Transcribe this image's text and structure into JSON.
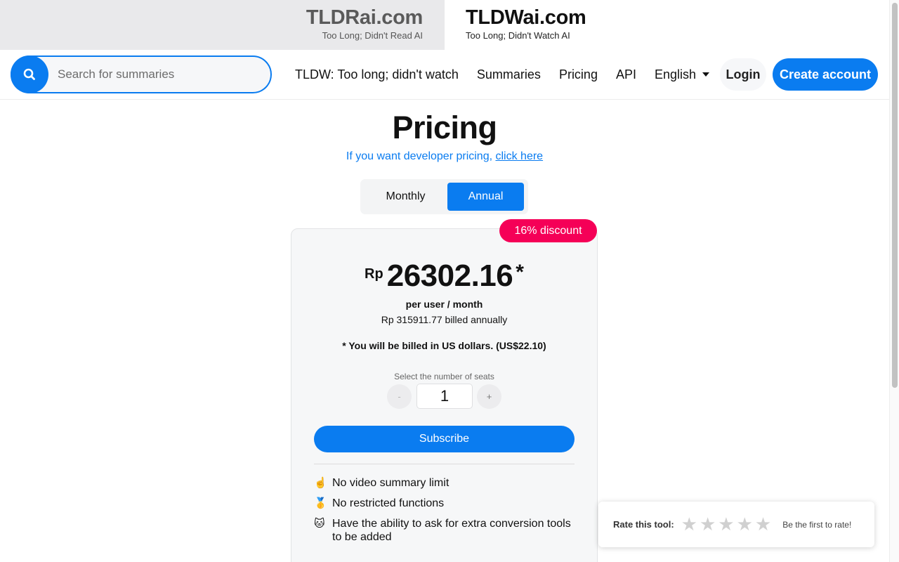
{
  "site_tabs": [
    {
      "name": "TLDRai.com",
      "subtitle": "Too Long; Didn't Read AI"
    },
    {
      "name": "TLDWai.com",
      "subtitle": "Too Long; Didn't Watch AI"
    }
  ],
  "search": {
    "placeholder": "Search for summaries"
  },
  "nav": {
    "links": [
      "TLDW: Too long; didn't watch",
      "Summaries",
      "Pricing",
      "API"
    ],
    "language": "English",
    "login": "Login",
    "create_account": "Create account"
  },
  "page": {
    "title": "Pricing",
    "dev_text": "If you want developer pricing, ",
    "dev_link": "click here"
  },
  "billing_toggle": {
    "monthly": "Monthly",
    "annual": "Annual",
    "selected": "Annual"
  },
  "plan": {
    "discount": "16% discount",
    "currency": "Rp",
    "amount": "26302.16",
    "asterisk": "*",
    "per": "per user / month",
    "billed": "Rp 315911.77 billed annually",
    "usd_note": "* You will be billed in US dollars. (US$22.10)",
    "seats_label": "Select the number of seats",
    "seats_value": "1",
    "minus": "-",
    "plus": "+",
    "subscribe": "Subscribe",
    "features": [
      {
        "emoji": "☝️",
        "text": "No video summary limit"
      },
      {
        "emoji": "🥇",
        "text": "No restricted functions"
      },
      {
        "emoji": "🐱",
        "text": "Have the ability to ask for extra conversion tools to be added"
      }
    ]
  },
  "rating": {
    "label": "Rate this tool:",
    "stars": [
      "★",
      "★",
      "★",
      "★",
      "★"
    ],
    "note": "Be the first to rate!"
  },
  "colors": {
    "accent": "#0a7cf0",
    "discount": "#f50057"
  }
}
